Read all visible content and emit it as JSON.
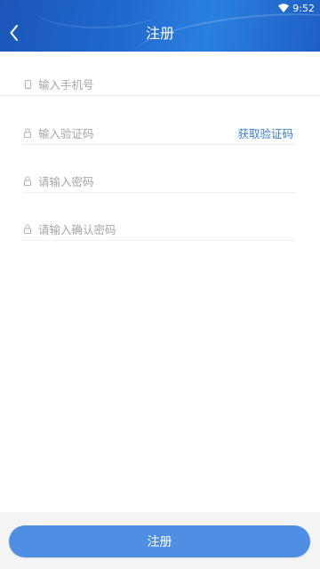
{
  "status_bar": {
    "time": "9:52",
    "wifi_icon": "wifi-icon"
  },
  "header": {
    "title": "注册",
    "back_icon": "chevron-left-icon"
  },
  "form": {
    "phone_placeholder": "输入手机号",
    "code_placeholder": "输入验证码",
    "get_code_label": "获取验证码",
    "password_placeholder": "请输入密码",
    "confirm_password_placeholder": "请输入确认密码",
    "field_icons": [
      "phone-icon",
      "lock-icon",
      "lock-icon",
      "lock-icon"
    ]
  },
  "footer": {
    "submit_label": "注册"
  },
  "colors": {
    "header": "#1f67cc",
    "accent": "#3c7dd6",
    "button": "#4f8fe3"
  }
}
